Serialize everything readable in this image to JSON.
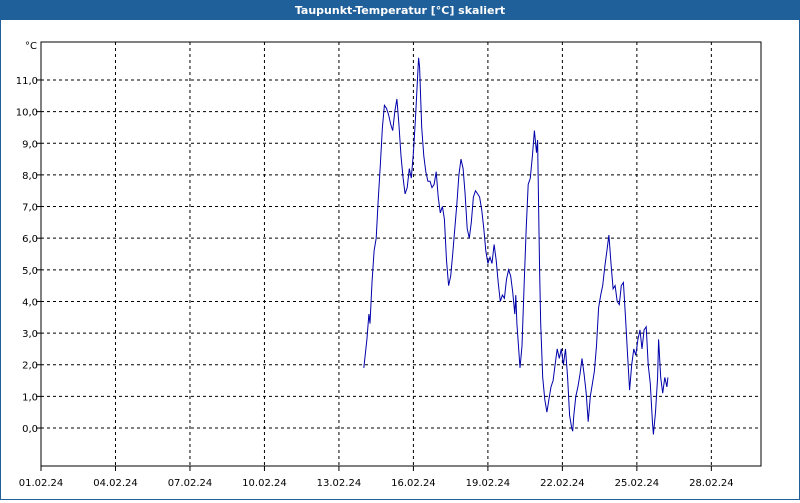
{
  "window": {
    "title": "Taupunkt-Temperatur [°C] skaliert"
  },
  "chart_data": {
    "type": "line",
    "title": "Taupunkt-Temperatur [°C] skaliert",
    "ylabel": "°C",
    "xlabel": "",
    "ylim": [
      -1.2,
      12.2
    ],
    "xlim": [
      "2024-02-01",
      "2024-03-01"
    ],
    "grid": true,
    "y_ticks": [
      "0,0",
      "1,0",
      "2,0",
      "3,0",
      "4,0",
      "5,0",
      "6,0",
      "7,0",
      "8,0",
      "9,0",
      "10,0",
      "11,0"
    ],
    "y_tick_values": [
      0,
      1,
      2,
      3,
      4,
      5,
      6,
      7,
      8,
      9,
      10,
      11
    ],
    "x_ticks": [
      "01.02.24",
      "04.02.24",
      "07.02.24",
      "10.02.24",
      "13.02.24",
      "16.02.24",
      "19.02.24",
      "22.02.24",
      "25.02.24",
      "28.02.24"
    ],
    "x_tick_values": [
      "2024-02-01",
      "2024-02-04",
      "2024-02-07",
      "2024-02-10",
      "2024-02-13",
      "2024-02-16",
      "2024-02-19",
      "2024-02-22",
      "2024-02-25",
      "2024-02-28"
    ],
    "series": [
      {
        "color": "#0000aa",
        "points": [
          [
            "2024-02-14 00:00",
            1.9
          ],
          [
            "2024-02-14 03:00",
            2.8
          ],
          [
            "2024-02-14 05:00",
            3.6
          ],
          [
            "2024-02-14 06:00",
            3.3
          ],
          [
            "2024-02-14 08:00",
            4.6
          ],
          [
            "2024-02-14 10:00",
            5.6
          ],
          [
            "2024-02-14 12:00",
            6.0
          ],
          [
            "2024-02-14 14:00",
            7.2
          ],
          [
            "2024-02-14 16:00",
            8.3
          ],
          [
            "2024-02-14 18:00",
            9.5
          ],
          [
            "2024-02-14 20:00",
            10.2
          ],
          [
            "2024-02-14 22:00",
            10.1
          ],
          [
            "2024-02-15 00:00",
            9.9
          ],
          [
            "2024-02-15 02:00",
            9.6
          ],
          [
            "2024-02-15 04:00",
            9.4
          ],
          [
            "2024-02-15 06:00",
            10.0
          ],
          [
            "2024-02-15 08:00",
            10.4
          ],
          [
            "2024-02-15 10:00",
            9.6
          ],
          [
            "2024-02-15 12:00",
            8.6
          ],
          [
            "2024-02-15 14:00",
            7.9
          ],
          [
            "2024-02-15 16:00",
            7.4
          ],
          [
            "2024-02-15 18:00",
            7.6
          ],
          [
            "2024-02-15 20:00",
            8.2
          ],
          [
            "2024-02-15 22:00",
            7.9
          ],
          [
            "2024-02-16 00:00",
            8.7
          ],
          [
            "2024-02-16 02:00",
            9.8
          ],
          [
            "2024-02-16 04:00",
            11.1
          ],
          [
            "2024-02-16 05:00",
            11.7
          ],
          [
            "2024-02-16 06:00",
            11.4
          ],
          [
            "2024-02-16 07:00",
            10.4
          ],
          [
            "2024-02-16 08:00",
            9.5
          ],
          [
            "2024-02-16 10:00",
            8.6
          ],
          [
            "2024-02-16 12:00",
            8.1
          ],
          [
            "2024-02-16 14:00",
            7.8
          ],
          [
            "2024-02-16 16:00",
            7.8
          ],
          [
            "2024-02-16 18:00",
            7.6
          ],
          [
            "2024-02-16 20:00",
            7.7
          ],
          [
            "2024-02-16 22:00",
            8.1
          ],
          [
            "2024-02-17 00:00",
            7.3
          ],
          [
            "2024-02-17 02:00",
            6.8
          ],
          [
            "2024-02-17 04:00",
            7.0
          ],
          [
            "2024-02-17 06:00",
            6.6
          ],
          [
            "2024-02-17 08:00",
            5.3
          ],
          [
            "2024-02-17 10:00",
            4.5
          ],
          [
            "2024-02-17 12:00",
            4.8
          ],
          [
            "2024-02-17 14:00",
            5.5
          ],
          [
            "2024-02-17 16:00",
            6.3
          ],
          [
            "2024-02-17 18:00",
            7.1
          ],
          [
            "2024-02-17 20:00",
            8.0
          ],
          [
            "2024-02-17 22:00",
            8.5
          ],
          [
            "2024-02-18 00:00",
            8.2
          ],
          [
            "2024-02-18 02:00",
            7.4
          ],
          [
            "2024-02-18 04:00",
            6.3
          ],
          [
            "2024-02-18 06:00",
            6.0
          ],
          [
            "2024-02-18 08:00",
            6.5
          ],
          [
            "2024-02-18 10:00",
            7.3
          ],
          [
            "2024-02-18 12:00",
            7.5
          ],
          [
            "2024-02-18 14:00",
            7.4
          ],
          [
            "2024-02-18 16:00",
            7.3
          ],
          [
            "2024-02-18 18:00",
            6.9
          ],
          [
            "2024-02-18 20:00",
            6.3
          ],
          [
            "2024-02-18 22:00",
            5.6
          ],
          [
            "2024-02-19 00:00",
            5.2
          ],
          [
            "2024-02-19 02:00",
            5.4
          ],
          [
            "2024-02-19 04:00",
            5.2
          ],
          [
            "2024-02-19 06:00",
            5.8
          ],
          [
            "2024-02-19 08:00",
            5.3
          ],
          [
            "2024-02-19 10:00",
            4.6
          ],
          [
            "2024-02-19 12:00",
            4.0
          ],
          [
            "2024-02-19 14:00",
            4.2
          ],
          [
            "2024-02-19 16:00",
            4.1
          ],
          [
            "2024-02-19 18:00",
            4.7
          ],
          [
            "2024-02-19 20:00",
            5.0
          ],
          [
            "2024-02-19 22:00",
            4.8
          ],
          [
            "2024-02-20 00:00",
            4.3
          ],
          [
            "2024-02-20 02:00",
            3.6
          ],
          [
            "2024-02-20 03:00",
            4.2
          ],
          [
            "2024-02-20 04:00",
            3.3
          ],
          [
            "2024-02-20 06:00",
            2.4
          ],
          [
            "2024-02-20 07:00",
            1.9
          ],
          [
            "2024-02-20 09:00",
            2.6
          ],
          [
            "2024-02-20 11:00",
            4.5
          ],
          [
            "2024-02-20 13:00",
            6.3
          ],
          [
            "2024-02-20 15:00",
            7.7
          ],
          [
            "2024-02-20 17:00",
            7.9
          ],
          [
            "2024-02-20 19:00",
            8.6
          ],
          [
            "2024-02-20 21:00",
            9.4
          ],
          [
            "2024-02-20 23:00",
            8.7
          ],
          [
            "2024-02-21 00:00",
            9.1
          ],
          [
            "2024-02-21 01:00",
            7.0
          ],
          [
            "2024-02-21 02:00",
            5.0
          ],
          [
            "2024-02-21 03:00",
            3.3
          ],
          [
            "2024-02-21 05:00",
            1.6
          ],
          [
            "2024-02-21 07:00",
            0.9
          ],
          [
            "2024-02-21 09:00",
            0.5
          ],
          [
            "2024-02-21 11:00",
            0.9
          ],
          [
            "2024-02-21 13:00",
            1.3
          ],
          [
            "2024-02-21 15:00",
            1.5
          ],
          [
            "2024-02-21 17:00",
            2.0
          ],
          [
            "2024-02-21 19:00",
            2.5
          ],
          [
            "2024-02-21 21:00",
            2.2
          ],
          [
            "2024-02-21 23:00",
            2.5
          ],
          [
            "2024-02-22 01:00",
            2.0
          ],
          [
            "2024-02-22 03:00",
            2.5
          ],
          [
            "2024-02-22 05:00",
            1.6
          ],
          [
            "2024-02-22 07:00",
            0.4
          ],
          [
            "2024-02-22 09:00",
            0.0
          ],
          [
            "2024-02-22 10:00",
            -0.1
          ],
          [
            "2024-02-22 11:00",
            0.4
          ],
          [
            "2024-02-22 13:00",
            1.0
          ],
          [
            "2024-02-22 15:00",
            1.3
          ],
          [
            "2024-02-22 17:00",
            1.7
          ],
          [
            "2024-02-22 19:00",
            2.2
          ],
          [
            "2024-02-22 21:00",
            1.7
          ],
          [
            "2024-02-22 23:00",
            1.1
          ],
          [
            "2024-02-23 01:00",
            0.2
          ],
          [
            "2024-02-23 03:00",
            1.0
          ],
          [
            "2024-02-23 05:00",
            1.4
          ],
          [
            "2024-02-23 07:00",
            1.8
          ],
          [
            "2024-02-23 09:00",
            2.6
          ],
          [
            "2024-02-23 11:00",
            3.8
          ],
          [
            "2024-02-23 13:00",
            4.2
          ],
          [
            "2024-02-23 15:00",
            4.5
          ],
          [
            "2024-02-23 17:00",
            5.1
          ],
          [
            "2024-02-23 19:00",
            5.6
          ],
          [
            "2024-02-23 21:00",
            6.1
          ],
          [
            "2024-02-23 23:00",
            5.2
          ],
          [
            "2024-02-24 01:00",
            4.4
          ],
          [
            "2024-02-24 03:00",
            4.5
          ],
          [
            "2024-02-24 05:00",
            4.0
          ],
          [
            "2024-02-24 07:00",
            3.9
          ],
          [
            "2024-02-24 09:00",
            4.5
          ],
          [
            "2024-02-24 11:00",
            4.6
          ],
          [
            "2024-02-24 13:00",
            3.5
          ],
          [
            "2024-02-24 15:00",
            2.3
          ],
          [
            "2024-02-24 17:00",
            1.2
          ],
          [
            "2024-02-24 19:00",
            2.0
          ],
          [
            "2024-02-24 21:00",
            2.5
          ],
          [
            "2024-02-24 23:00",
            2.3
          ],
          [
            "2024-02-25 01:00",
            2.8
          ],
          [
            "2024-02-25 03:00",
            3.1
          ],
          [
            "2024-02-25 05:00",
            2.5
          ],
          [
            "2024-02-25 07:00",
            3.1
          ],
          [
            "2024-02-25 09:00",
            3.2
          ],
          [
            "2024-02-25 11:00",
            2.0
          ],
          [
            "2024-02-25 13:00",
            1.4
          ],
          [
            "2024-02-25 15:00",
            0.2
          ],
          [
            "2024-02-25 16:00",
            -0.2
          ],
          [
            "2024-02-25 18:00",
            0.5
          ],
          [
            "2024-02-25 20:00",
            1.6
          ],
          [
            "2024-02-25 21:00",
            2.8
          ],
          [
            "2024-02-25 23:00",
            1.6
          ],
          [
            "2024-02-26 01:00",
            1.1
          ],
          [
            "2024-02-26 03:00",
            1.6
          ],
          [
            "2024-02-26 05:00",
            1.3
          ],
          [
            "2024-02-26 06:00",
            1.6
          ]
        ]
      }
    ]
  }
}
